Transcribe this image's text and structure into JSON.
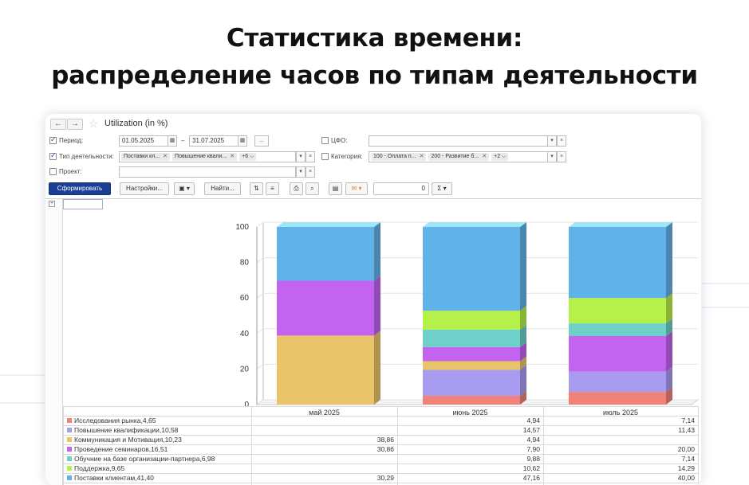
{
  "headline": {
    "line1": "Статистика времени:",
    "line2": "распределение часов по типам деятельности"
  },
  "window": {
    "title": "Utilization (in %)",
    "nav": {
      "back": "←",
      "forward": "→"
    }
  },
  "filters": {
    "period": {
      "label": "Период:",
      "checked": true,
      "from": "01.05.2025",
      "to": "31.07.2025",
      "separator": "–",
      "more_button": "..."
    },
    "activity_type": {
      "label": "Тип деятельности:",
      "checked": true,
      "tags": [
        "Поставки кл...",
        "Повышение квали..."
      ],
      "more": "+6"
    },
    "project": {
      "label": "Проект:",
      "checked": false,
      "value": ""
    },
    "cfo": {
      "label": "ЦФО:",
      "checked": false,
      "value": ""
    },
    "category": {
      "label": "Категория:",
      "checked": false,
      "tags": [
        "100 - Оплата п...",
        "200 - Развитие б..."
      ],
      "more": "+2"
    }
  },
  "toolbar": {
    "generate": "Сформировать",
    "settings": "Настройки...",
    "find": "Найти...",
    "number_value": "0",
    "sigma": "Σ"
  },
  "chart_data": {
    "type": "bar",
    "stacked": true,
    "categories": [
      "май 2025",
      "июнь 2025",
      "июль 2025"
    ],
    "ylim": [
      0,
      100
    ],
    "yticks": [
      0,
      20,
      40,
      60,
      80,
      100
    ],
    "series": [
      {
        "name": "Исследования рынка,4,65",
        "color": "#f0827a",
        "values": [
          0,
          4.94,
          7.14
        ],
        "labels": [
          "",
          "4,94",
          "7,14"
        ]
      },
      {
        "name": "Повышение квалификации,10,58",
        "color": "#a89cf0",
        "values": [
          0,
          14.57,
          11.43
        ],
        "labels": [
          "",
          "14,57",
          "11,43"
        ]
      },
      {
        "name": "Коммуникация и Мотивация,10,23",
        "color": "#e9c46a",
        "values": [
          38.86,
          4.94,
          0
        ],
        "labels": [
          "38,86",
          "4,94",
          ""
        ]
      },
      {
        "name": "Проведение семинаров,16,51",
        "color": "#c264f0",
        "values": [
          30.86,
          7.9,
          20.0
        ],
        "labels": [
          "30,86",
          "7,90",
          "20,00"
        ]
      },
      {
        "name": "Обучние на базе организации-партнера,6,98",
        "color": "#6ed0c8",
        "values": [
          0,
          9.88,
          7.14
        ],
        "labels": [
          "",
          "9,88",
          "7,14"
        ]
      },
      {
        "name": "Поддержка,9,65",
        "color": "#b6f04a",
        "values": [
          0,
          10.62,
          14.29
        ],
        "labels": [
          "",
          "10,62",
          "14,29"
        ]
      },
      {
        "name": "Поставки клиентам,41,40",
        "color": "#62b2ea",
        "values": [
          30.29,
          47.16,
          40.0
        ],
        "labels": [
          "30,29",
          "47,16",
          "40,00"
        ]
      }
    ]
  }
}
